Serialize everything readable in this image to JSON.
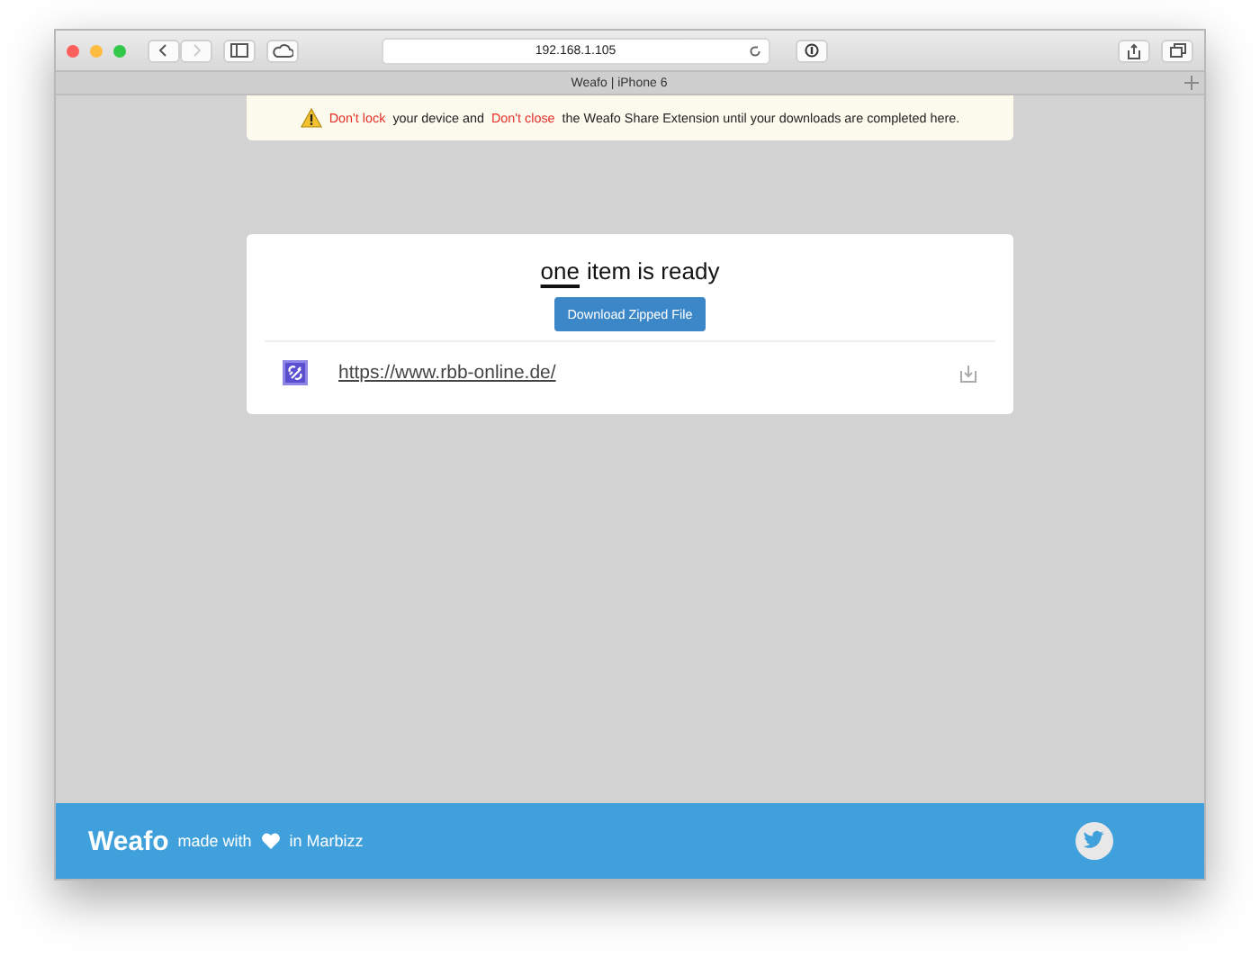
{
  "browser": {
    "address": "192.168.1.105",
    "tab_title": "Weafo | iPhone 6"
  },
  "notice": [
    {
      "kind": "warning",
      "text": "Don't lock"
    },
    {
      "kind": "plain",
      "text": "your device and"
    },
    {
      "kind": "warning",
      "text": "Don't close"
    },
    {
      "kind": "plain",
      "text": "the Weafo Share Extension until your downloads are completed here."
    }
  ],
  "card": {
    "count": "one",
    "heading": "item is ready",
    "button": "Download Zipped File",
    "items": [
      {
        "url": "https://www.rbb-online.de/"
      }
    ]
  },
  "footer": {
    "brand": "Weafo",
    "made_with": "made with",
    "place": "in Marbizz"
  }
}
